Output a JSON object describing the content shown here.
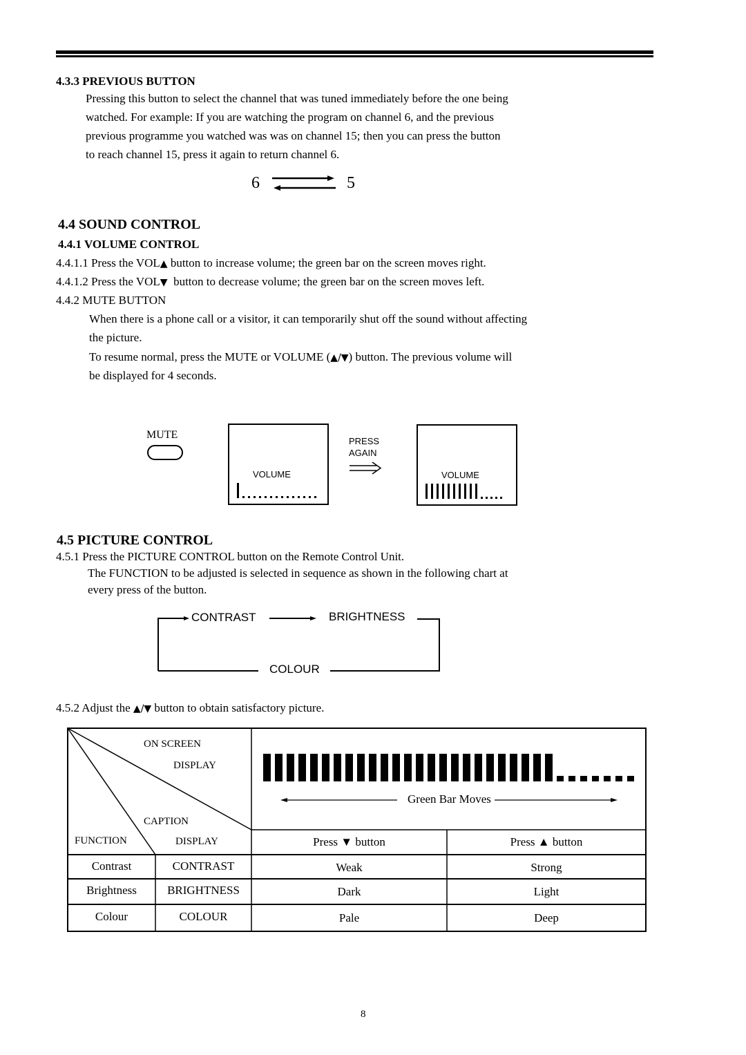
{
  "page_number": "8",
  "section_4_3_3": {
    "heading": "4.3.3 PREVIOUS BUTTON",
    "lines": [
      "Pressing this button to select the channel that was tuned immediately before the one being",
      "watched. For example: If you are watching the program on channel 6, and the previous",
      "previous programme you watched was was on channel 15; then you can press the button",
      "to reach channel 15, press it again to return channel 6."
    ],
    "diagram": {
      "left_channel": "6",
      "right_channel": "5"
    }
  },
  "section_4_4": {
    "heading": "4.4 SOUND CONTROL",
    "sub_heading": "4.4.1 VOLUME CONTROL",
    "item_1_prefix": "4.4.1.1 Press the VOL",
    "item_1_suffix": "button to increase volume; the green bar on the screen moves right.",
    "item_2_prefix": "4.4.1.2 Press the VOL",
    "item_2_suffix": "button to decrease volume; the green bar on the screen moves left.",
    "up_symbol": "▲",
    "down_symbol": "▼",
    "mute_heading": "4.4.2 MUTE BUTTON",
    "mute_line_1": "When there is a phone call or a visitor, it can temporarily shut off the sound without affecting",
    "mute_line_2": "the picture.",
    "mute_line_3_prefix": "To resume normal, press the MUTE or VOLUME (",
    "mute_line_3_symbols": "▲/▼",
    "mute_line_3_suffix": ") button. The previous volume will",
    "mute_line_4": "be displayed for 4 seconds.",
    "mute_diagram": {
      "mute_label": "MUTE",
      "press_again_line_1": "PRESS",
      "press_again_line_2": "AGAIN",
      "arrow_symbol": "⇒",
      "screen_1": {
        "label": "VOLUME",
        "bars_filled": 1,
        "dots_remaining": 14
      },
      "screen_2": {
        "label": "VOLUME",
        "bars_filled": 10,
        "dots_remaining": 5
      }
    }
  },
  "section_4_5": {
    "heading": "4.5 PICTURE CONTROL",
    "item_1": "4.5.1 Press the PICTURE CONTROL button on the Remote Control Unit.",
    "item_1_line_2": "The FUNCTION to be adjusted is selected in sequence as shown in the following chart at",
    "item_1_line_3": "every press of the button.",
    "cycle": {
      "step_1": "CONTRAST",
      "step_2": "BRIGHTNESS",
      "step_3": "COLOUR"
    },
    "item_2_prefix": "4.5.2  Adjust the",
    "item_2_symbols": "▲/▼",
    "item_2_suffix": "button to obtain satisfactory picture.",
    "table": {
      "corner_on_screen_1": "ON SCREEN",
      "corner_on_screen_2": "DISPLAY",
      "corner_caption_1": "CAPTION",
      "corner_caption_2": "DISPLAY",
      "corner_function": "FUNCTION",
      "bar_display": {
        "bars_filled": 25,
        "dots_remaining": 7,
        "caption": "Green Bar Moves"
      },
      "header_down": "Press ▼ button",
      "header_up": "Press ▲ button",
      "rows": [
        {
          "function": "Contrast",
          "caption": "CONTRAST",
          "down": "Weak",
          "up": "Strong"
        },
        {
          "function": "Brightness",
          "caption": "BRIGHTNESS",
          "down": "Dark",
          "up": "Light"
        },
        {
          "function": "Colour",
          "caption": "COLOUR",
          "down": "Pale",
          "up": "Deep"
        }
      ]
    }
  }
}
